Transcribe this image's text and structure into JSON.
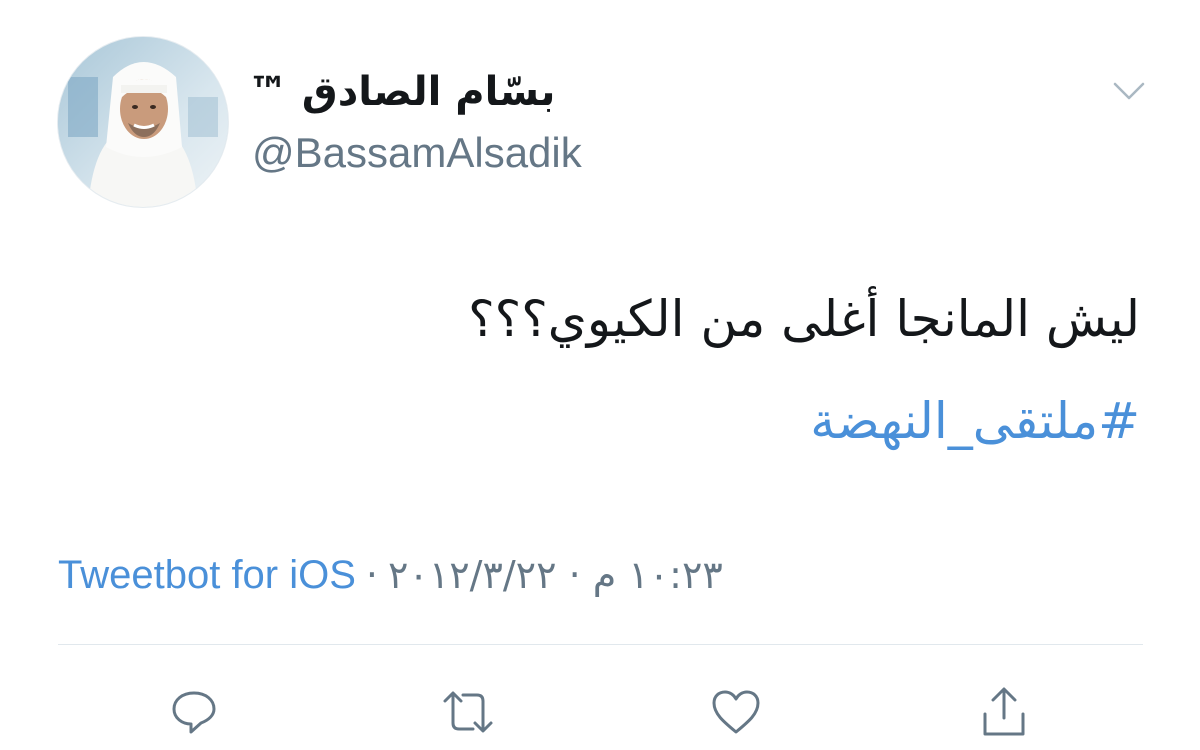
{
  "tweet": {
    "display_name": "بسّام الصادق ™",
    "handle": "@BassamAlsadik",
    "text": "ليش المانجا أغلى من الكيوي؟؟؟",
    "hashtag": "#ملتقى_النهضة",
    "timestamp": "١٠:٢٣ م · ٢٠١٢/٣/٢٢",
    "separator": "·",
    "client": "Tweetbot for iOS"
  },
  "icons": {
    "menu": "chevron-down-icon",
    "reply": "reply-icon",
    "retweet": "retweet-icon",
    "like": "heart-icon",
    "share": "share-icon"
  },
  "colors": {
    "text": "#14171a",
    "secondary": "#657786",
    "link": "#4a90d9",
    "divider": "#e1e8ed"
  }
}
